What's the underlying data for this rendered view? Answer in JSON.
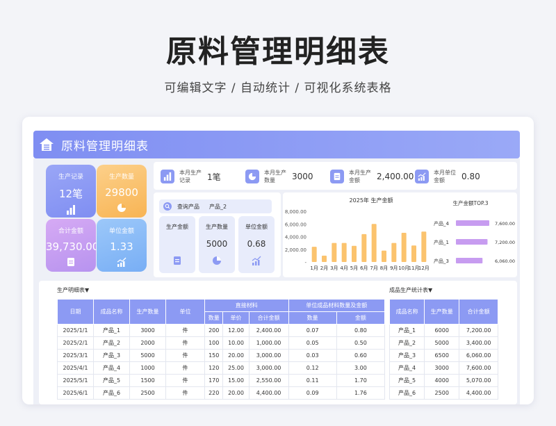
{
  "hero": {
    "title": "原料管理明细表",
    "subtitle": "可编辑文字 / 自动统计 / 可视化系统表格"
  },
  "banner": {
    "title": "原料管理明细表"
  },
  "kpis": [
    {
      "label": "生产记录",
      "value": "12笔",
      "icon": "bar-chart-icon",
      "color": "#8c9af3"
    },
    {
      "label": "生产数量",
      "value": "29800",
      "icon": "pie-chart-icon",
      "color": "#fbc36e"
    },
    {
      "label": "合计金额",
      "value": "39,730.00",
      "icon": "document-icon",
      "color": "#c79cf0"
    },
    {
      "label": "单位金额",
      "value": "1.33",
      "icon": "trend-chart-icon",
      "color": "#86b8f7"
    }
  ],
  "month_stats": [
    {
      "label": "本月生产记录",
      "value": "1笔",
      "icon": "bar-chart-icon"
    },
    {
      "label": "本月生产数量",
      "value": "3000",
      "icon": "pie-chart-icon"
    },
    {
      "label": "本月生产金额",
      "value": "2,400.00",
      "icon": "document-icon"
    },
    {
      "label": "本月单位金额",
      "value": "0.80",
      "icon": "trend-chart-icon"
    }
  ],
  "query": {
    "label": "查询产品",
    "product": "产品_2",
    "cards": [
      {
        "label": "生产金额",
        "value": "",
        "icon": "document-icon"
      },
      {
        "label": "生产数量",
        "value": "5000",
        "icon": "pie-chart-icon"
      },
      {
        "label": "单位金额",
        "value": "0.68",
        "icon": "trend-chart-icon"
      }
    ]
  },
  "chart_data": [
    {
      "type": "bar",
      "title": "2025年 生产金额",
      "categories": [
        "1月",
        "2月",
        "3月",
        "4月",
        "5月",
        "6月",
        "7月",
        "8月",
        "9月",
        "10月",
        "11月",
        "12月"
      ],
      "values": [
        2400,
        1000,
        3000,
        3000,
        2550,
        4400,
        6000,
        1800,
        3000,
        4600,
        2600,
        4800
      ],
      "y_ticks": [
        "8,000.00",
        "6,000.00",
        "4,000.00",
        "2,000.00",
        "-"
      ],
      "ylim": [
        0,
        8000
      ],
      "color": "#fbc36e"
    },
    {
      "type": "bar",
      "title": "生产金额TOP.3",
      "categories": [
        "产品_4",
        "产品_1",
        "产品_3"
      ],
      "values": [
        7600,
        7200,
        6060
      ],
      "value_labels": [
        "7,600.00",
        "7,200.00",
        "6,060.00"
      ],
      "orientation": "horizontal",
      "color": "#c79cf0"
    }
  ],
  "detail_table": {
    "title": "生产明细表▼",
    "header_groups": {
      "direct": "直接材料",
      "unit": "单位成品材料数量及金额"
    },
    "columns": [
      "日期",
      "成品名称",
      "生产数量",
      "单位",
      "数量",
      "单价",
      "合计金额",
      "数量",
      "金额"
    ],
    "rows": [
      [
        "2025/1/1",
        "产品_1",
        "3000",
        "件",
        "200",
        "12.00",
        "2,400.00",
        "0.07",
        "0.80"
      ],
      [
        "2025/2/1",
        "产品_2",
        "2000",
        "件",
        "100",
        "10.00",
        "1,000.00",
        "0.05",
        "0.50"
      ],
      [
        "2025/3/1",
        "产品_3",
        "5000",
        "件",
        "150",
        "20.00",
        "3,000.00",
        "0.03",
        "0.60"
      ],
      [
        "2025/4/1",
        "产品_4",
        "1000",
        "件",
        "120",
        "25.00",
        "3,000.00",
        "0.12",
        "3.00"
      ],
      [
        "2025/5/1",
        "产品_5",
        "1500",
        "件",
        "170",
        "15.00",
        "2,550.00",
        "0.11",
        "1.70"
      ],
      [
        "2025/6/1",
        "产品_6",
        "2500",
        "件",
        "220",
        "20.00",
        "4,400.00",
        "0.09",
        "1.76"
      ]
    ]
  },
  "summary_table": {
    "title": "成品生产统计表▼",
    "columns": [
      "成品名称",
      "生产数量",
      "合计金额"
    ],
    "rows": [
      [
        "产品_1",
        "6000",
        "7,200.00"
      ],
      [
        "产品_2",
        "5000",
        "3,400.00"
      ],
      [
        "产品_3",
        "6500",
        "6,060.00"
      ],
      [
        "产品_4",
        "3000",
        "7,600.00"
      ],
      [
        "产品_5",
        "4000",
        "5,070.00"
      ],
      [
        "产品_6",
        "2500",
        "4,400.00"
      ]
    ]
  }
}
